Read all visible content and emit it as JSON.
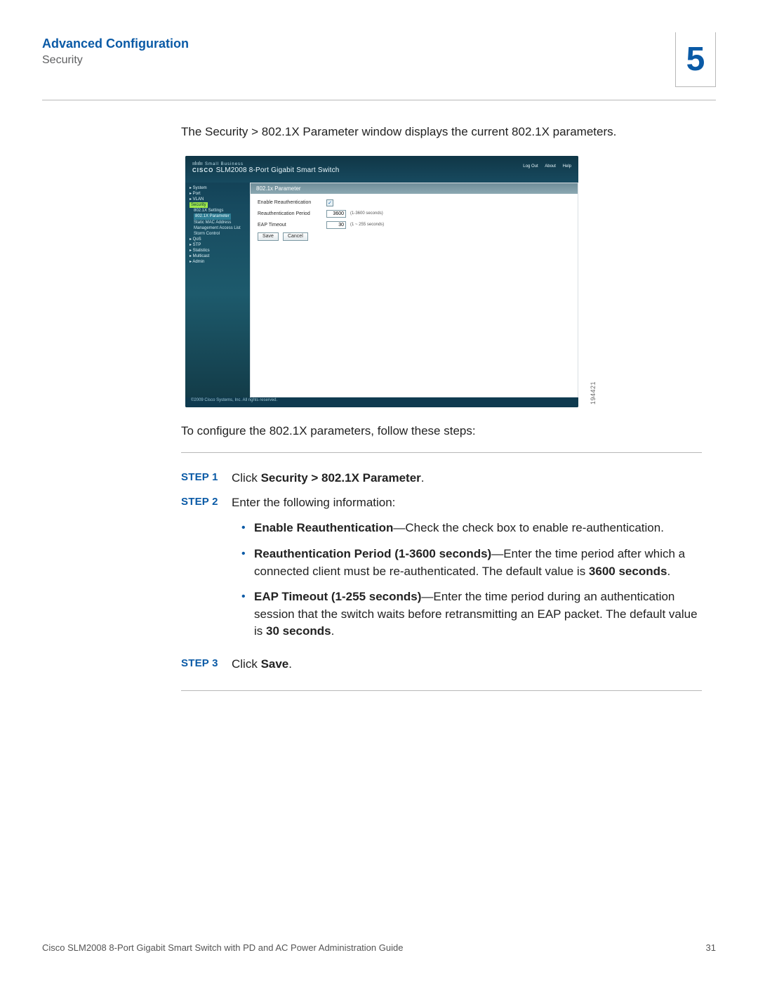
{
  "header": {
    "title": "Advanced Configuration",
    "subtitle": "Security",
    "chapter_number": "5"
  },
  "intro": "The Security > 802.1X Parameter window displays the current 802.1X parameters.",
  "lead": "To configure the 802.1X parameters, follow these steps:",
  "screenshot": {
    "brand_bars": "ıılıılıı",
    "brand_name": "CISCO",
    "brand_small": "Small Business",
    "product": "SLM2008 8-Port Gigabit Smart Switch",
    "top_links": {
      "logout": "Log Out",
      "about": "About",
      "help": "Help"
    },
    "nav": {
      "system": "▸ System",
      "port": "▸ Port",
      "vlan": "▸ VLAN",
      "security": "Security",
      "sec_settings": "802.1X Settings",
      "sec_param": "802.1X Parameter",
      "sec_mac": "Static MAC Address",
      "sec_acl": "Management Access List",
      "sec_storm": "Storm Control",
      "qos": "▸ QoS",
      "stp": "▸ STP",
      "stats": "▸ Statistics",
      "multicast": "▸ Multicast",
      "admin": "▸ Admin"
    },
    "panel_title": "802.1x Parameter",
    "form": {
      "enable_label": "Enable Reauthentication",
      "enable_checked": "✓",
      "period_label": "Reauthentication Period",
      "period_value": "3600",
      "period_hint": "(1-3600 seconds)",
      "eap_label": "EAP Timeout",
      "eap_value": "30",
      "eap_hint": "(1 ~ 255 seconds)",
      "save": "Save",
      "cancel": "Cancel"
    },
    "copyright": "©2009 Cisco Systems, Inc. All rights reserved.",
    "side_code": "194421"
  },
  "steps": {
    "s1_label": "STEP 1",
    "s1_pre": "Click ",
    "s1_bold": "Security > 802.1X Parameter",
    "s1_post": ".",
    "s2_label": "STEP 2",
    "s2_text": "Enter the following information:",
    "b1_bold": "Enable Reauthentication",
    "b1_rest": "—Check the check box to enable re-authentication.",
    "b2_bold": "Reauthentication Period (1-3600 seconds)",
    "b2_rest1": "—Enter the time period after which a connected client must be re-authenticated. The default value is ",
    "b2_bold2": "3600 seconds",
    "b2_rest2": ".",
    "b3_bold": "EAP Timeout (1-255 seconds)",
    "b3_rest1": "—Enter the time period during an authentication session that the switch waits before retransmitting an EAP packet. The default value is ",
    "b3_bold2": "30 seconds",
    "b3_rest2": ".",
    "s3_label": "STEP 3",
    "s3_pre": "Click ",
    "s3_bold": "Save",
    "s3_post": "."
  },
  "footer": {
    "left": "Cisco SLM2008 8-Port Gigabit Smart Switch with PD and AC Power Administration Guide",
    "right": "31"
  }
}
